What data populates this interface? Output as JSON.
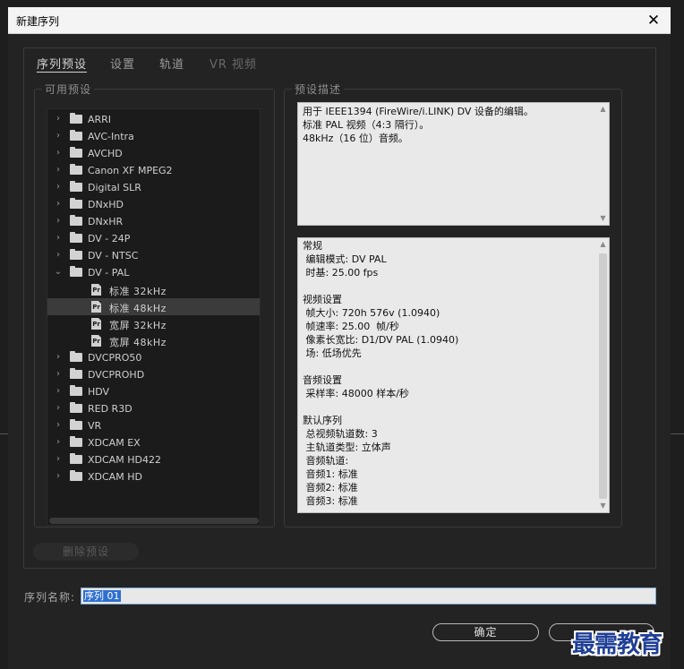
{
  "dialog": {
    "title": "新建序列",
    "close_glyph": "✕"
  },
  "tabs": [
    {
      "label": "序列预设",
      "state": "active"
    },
    {
      "label": "设置",
      "state": "normal"
    },
    {
      "label": "轨道",
      "state": "normal"
    },
    {
      "label": "VR 视频",
      "state": "disabled"
    }
  ],
  "presets": {
    "legend": "可用预设",
    "tree": [
      {
        "label": "ARRI",
        "type": "folder",
        "expanded": false
      },
      {
        "label": "AVC-Intra",
        "type": "folder",
        "expanded": false
      },
      {
        "label": "AVCHD",
        "type": "folder",
        "expanded": false
      },
      {
        "label": "Canon XF MPEG2",
        "type": "folder",
        "expanded": false
      },
      {
        "label": "Digital SLR",
        "type": "folder",
        "expanded": false
      },
      {
        "label": "DNxHD",
        "type": "folder",
        "expanded": false
      },
      {
        "label": "DNxHR",
        "type": "folder",
        "expanded": false
      },
      {
        "label": "DV - 24P",
        "type": "folder",
        "expanded": false
      },
      {
        "label": "DV - NTSC",
        "type": "folder",
        "expanded": false
      },
      {
        "label": "DV - PAL",
        "type": "folder",
        "expanded": true
      },
      {
        "label": "标准 32kHz",
        "type": "preset"
      },
      {
        "label": "标准 48kHz",
        "type": "preset",
        "selected": true
      },
      {
        "label": "宽屏 32kHz",
        "type": "preset"
      },
      {
        "label": "宽屏 48kHz",
        "type": "preset"
      },
      {
        "label": "DVCPRO50",
        "type": "folder",
        "expanded": false
      },
      {
        "label": "DVCPROHD",
        "type": "folder",
        "expanded": false
      },
      {
        "label": "HDV",
        "type": "folder",
        "expanded": false
      },
      {
        "label": "RED R3D",
        "type": "folder",
        "expanded": false
      },
      {
        "label": "VR",
        "type": "folder",
        "expanded": false
      },
      {
        "label": "XDCAM EX",
        "type": "folder",
        "expanded": false
      },
      {
        "label": "XDCAM HD422",
        "type": "folder",
        "expanded": false
      },
      {
        "label": "XDCAM HD",
        "type": "folder",
        "expanded": false
      }
    ],
    "delete_button": "删除预设"
  },
  "description": {
    "legend": "预设描述",
    "lines": [
      "用于 IEEE1394 (FireWire/i.LINK) DV 设备的编辑。",
      "标准 PAL 视频（4:3 隔行）。",
      "48kHz（16 位）音频。"
    ]
  },
  "details": {
    "lines": [
      "常规",
      " 编辑模式: DV PAL",
      " 时基: 25.00 fps",
      "",
      "视频设置",
      " 帧大小: 720h 576v (1.0940)",
      " 帧速率: 25.00  帧/秒",
      " 像素长宽比: D1/DV PAL (1.0940)",
      " 场: 低场优先",
      "",
      "音频设置",
      " 采样率: 48000 样本/秒",
      "",
      "默认序列",
      " 总视频轨道数: 3",
      " 主轨道类型: 立体声",
      " 音频轨道:",
      " 音频1: 标准",
      " 音频2: 标准",
      " 音频3: 标准"
    ]
  },
  "sequence_name": {
    "label": "序列名称:",
    "value": "序列 01"
  },
  "buttons": {
    "ok": "确定",
    "cancel": ""
  },
  "watermark": "最需教育"
}
